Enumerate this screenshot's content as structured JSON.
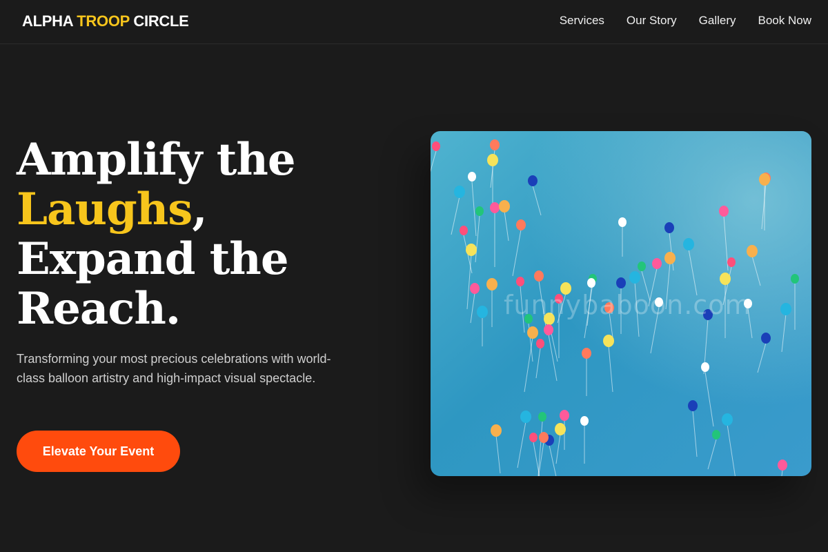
{
  "brand": {
    "part1": "ALPHA",
    "part2": "TROOP",
    "part3": "CIRCLE",
    "accent_color": "#f7c51c"
  },
  "nav": {
    "items": [
      "Services",
      "Our Story",
      "Gallery",
      "Book Now"
    ]
  },
  "hero": {
    "line1": "Amplify the",
    "highlight": "Laughs",
    "highlight_suffix": ",",
    "line3": "Expand the",
    "line4": "Reach.",
    "subtext": "Transforming your most precious celebrations with world-class balloon artistry and high-impact visual spectacle.",
    "cta_label": "Elevate Your Event",
    "cta_color": "#ff4b0d"
  },
  "image": {
    "subject": "colorful balloons floating in blue sky",
    "watermark": "funnybaboon.com"
  }
}
